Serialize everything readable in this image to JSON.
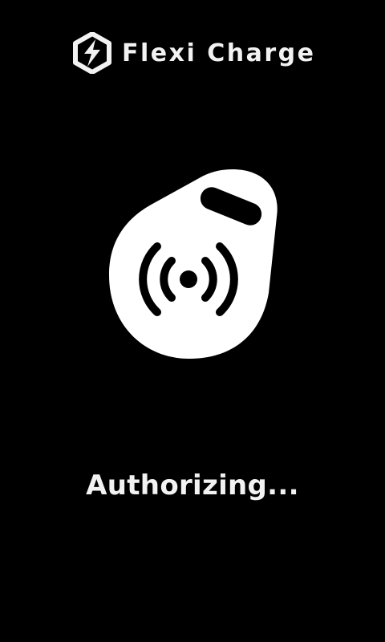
{
  "header": {
    "brand_name": "Flexi Charge",
    "logo_icon": "flexi-charge-hexagon-logo-icon"
  },
  "main": {
    "illustration_icon": "rfid-tag-icon",
    "status_text": "Authorizing..."
  },
  "colors": {
    "background": "#000000",
    "foreground": "#ffffff",
    "text": "#f2f2f2"
  }
}
